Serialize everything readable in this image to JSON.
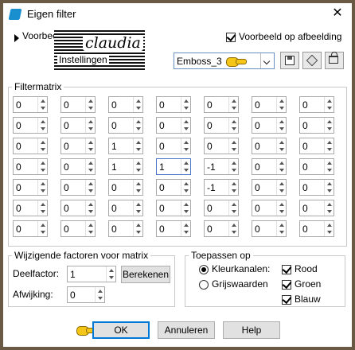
{
  "window": {
    "title": "Eigen filter"
  },
  "preview": {
    "label": "Voorbeeld",
    "logo_main": "claudia",
    "logo_sub": "Instellingen",
    "checkbox_label": "Voorbeeld op afbeelding",
    "checkbox_checked": true
  },
  "preset": {
    "value": "Emboss_3"
  },
  "matrix": {
    "legend": "Filtermatrix",
    "rows": [
      [
        "0",
        "0",
        "0",
        "0",
        "0",
        "0",
        "0"
      ],
      [
        "0",
        "0",
        "0",
        "0",
        "0",
        "0",
        "0"
      ],
      [
        "0",
        "0",
        "1",
        "0",
        "0",
        "0",
        "0"
      ],
      [
        "0",
        "0",
        "1",
        "1",
        "-1",
        "0",
        "0"
      ],
      [
        "0",
        "0",
        "0",
        "0",
        "-1",
        "0",
        "0"
      ],
      [
        "0",
        "0",
        "0",
        "0",
        "0",
        "0",
        "0"
      ],
      [
        "0",
        "0",
        "0",
        "0",
        "0",
        "0",
        "0"
      ]
    ]
  },
  "factors": {
    "legend": "Wijzigende factoren voor matrix",
    "divisor_label": "Deelfactor:",
    "divisor_value": "1",
    "calc_button": "Berekenen",
    "offset_label": "Afwijking:",
    "offset_value": "0"
  },
  "apply": {
    "legend": "Toepassen op",
    "color_channels_label": "Kleurkanalen:",
    "grayscale_label": "Grijswaarden",
    "selected": "Kleurkanalen:",
    "red_label": "Rood",
    "green_label": "Groen",
    "blue_label": "Blauw",
    "red_checked": true,
    "green_checked": true,
    "blue_checked": true
  },
  "buttons": {
    "ok": "OK",
    "cancel": "Annuleren",
    "help": "Help"
  },
  "colors": {
    "accent": "#0078d7",
    "pointer": "#f5c518",
    "frame": "#6a5a44"
  }
}
